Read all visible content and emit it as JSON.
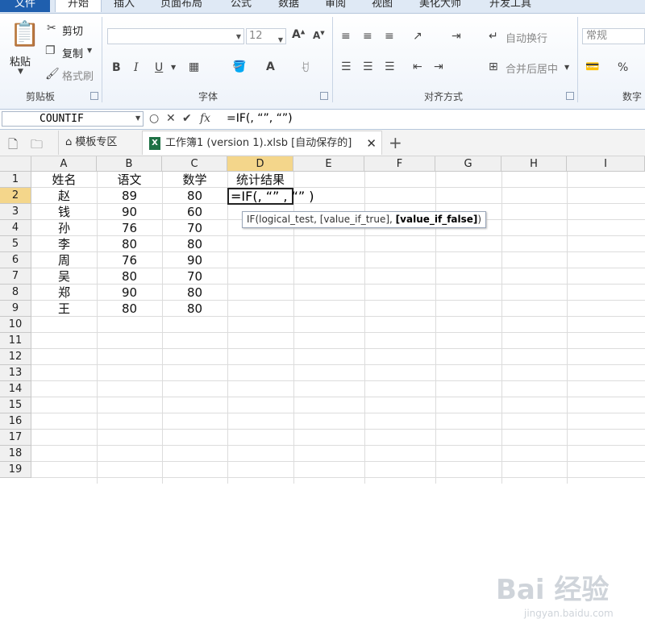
{
  "menu": {
    "tabs": [
      "文件",
      "开始",
      "插入",
      "页面布局",
      "公式",
      "数据",
      "审阅",
      "视图",
      "美化大师",
      "开发工具"
    ]
  },
  "ribbon": {
    "clipboard": {
      "paste": "粘贴",
      "cut": "剪切",
      "copy": "复制",
      "format_painter": "格式刷",
      "group": "剪贴板"
    },
    "font": {
      "size": "12",
      "group": "字体"
    },
    "alignment": {
      "wrap_text": "自动换行",
      "merge_center": "合并后居中",
      "group": "对齐方式"
    },
    "number": {
      "format": "常规",
      "percent": "%",
      "group": "数字"
    }
  },
  "formula_bar": {
    "name_box": "COUNTIF",
    "formula": "=IF(, “”, “”)"
  },
  "doc_tabs": {
    "template": "模板专区",
    "workbook": "工作簿1 (version 1).xlsb [自动保存的]",
    "add": "+"
  },
  "sheet": {
    "columns": [
      "A",
      "B",
      "C",
      "D",
      "E",
      "F",
      "G",
      "H",
      "I"
    ],
    "rows": [
      "1",
      "2",
      "3",
      "4",
      "5",
      "6",
      "7",
      "8",
      "9",
      "10",
      "11",
      "12",
      "13",
      "14",
      "15",
      "16",
      "17",
      "18",
      "19"
    ],
    "header_row": [
      "姓名",
      "语文",
      "数学",
      "统计结果"
    ],
    "data": [
      [
        "赵",
        "89",
        "80"
      ],
      [
        "钱",
        "90",
        "60"
      ],
      [
        "孙",
        "76",
        "70"
      ],
      [
        "李",
        "80",
        "80"
      ],
      [
        "周",
        "76",
        "90"
      ],
      [
        "吴",
        "80",
        "70"
      ],
      [
        "郑",
        "90",
        "80"
      ],
      [
        "王",
        "80",
        "80"
      ]
    ],
    "active_cell_edit": "=IF(, “” , “”  )",
    "tooltip_prefix": "IF(logical_test, [value_if_true], ",
    "tooltip_bold": "[value_if_false]",
    "tooltip_suffix": ")"
  },
  "watermark": {
    "main": "Bai 经验",
    "sub": "jingyan.baidu.com"
  }
}
